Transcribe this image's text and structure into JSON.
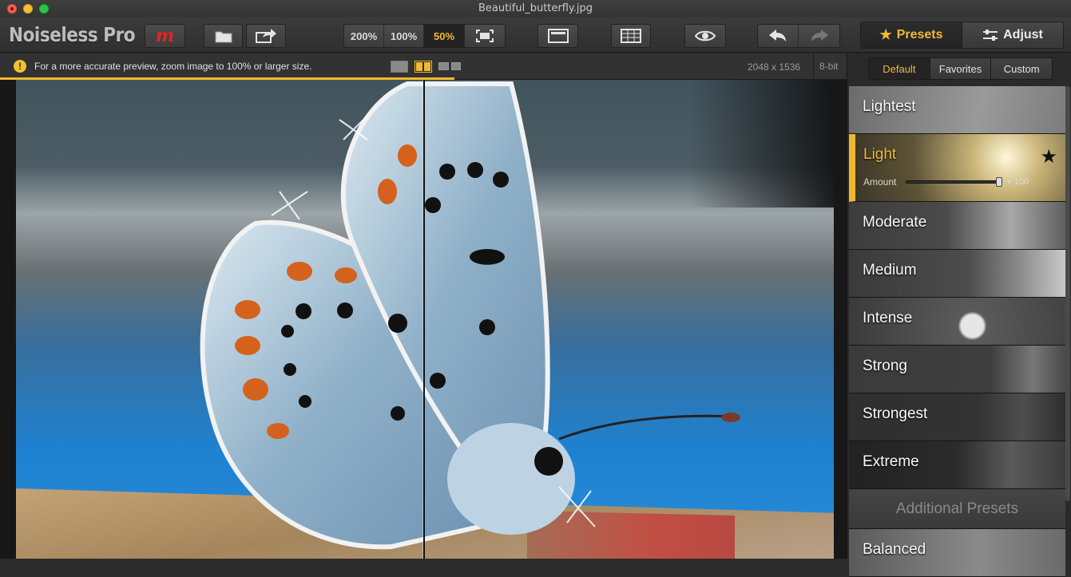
{
  "window": {
    "title": "Beautiful_butterfly.jpg"
  },
  "toolbar": {
    "app_name": "Noiseless Pro",
    "brand_label": "m",
    "zoom": {
      "z200": "200%",
      "z100": "100%",
      "z50": "50%",
      "selected": "50%"
    },
    "tabs": {
      "presets": "Presets",
      "adjust": "Adjust",
      "active": "Presets"
    }
  },
  "infobar": {
    "message": "For a more accurate preview, zoom image to 100% or larger size.",
    "dimensions": "2048 x 1536",
    "bit_depth": "8-bit",
    "view_mode": "split",
    "preview_progress": 0.537
  },
  "panel": {
    "tabs": {
      "default": "Default",
      "favorites": "Favorites",
      "custom": "Custom",
      "active": "Default"
    },
    "presets": [
      {
        "name": "Lightest"
      },
      {
        "name": "Light",
        "selected": true,
        "favorite": true,
        "amount_label": "Amount",
        "amount_value": "+ 100"
      },
      {
        "name": "Moderate"
      },
      {
        "name": "Medium"
      },
      {
        "name": "Intense"
      },
      {
        "name": "Strong"
      },
      {
        "name": "Strongest"
      },
      {
        "name": "Extreme"
      }
    ],
    "additional_presets": "Additional Presets",
    "extra_presets": [
      {
        "name": "Balanced"
      }
    ]
  },
  "colors": {
    "accent": "#f0b92d",
    "brand_red": "#e32424"
  }
}
